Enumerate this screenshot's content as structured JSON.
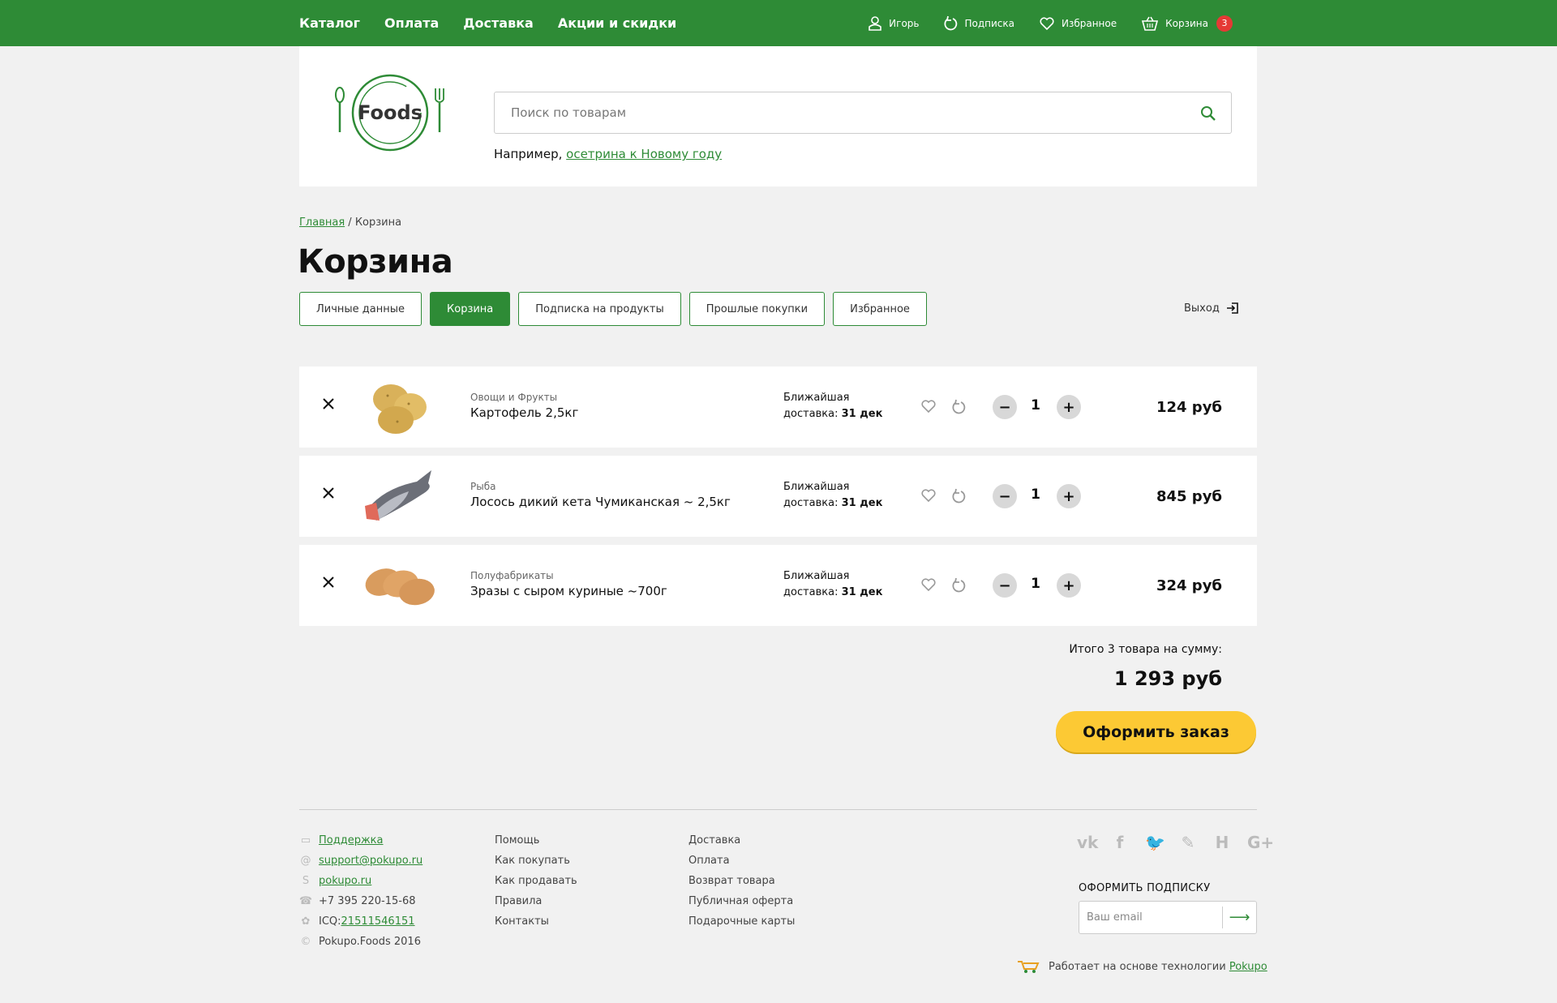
{
  "topnav": {
    "items": [
      "Каталог",
      "Оплата",
      "Доставка",
      "Акции и скидки"
    ]
  },
  "toputils": {
    "user": "Игорь",
    "subscription": "Подписка",
    "favorites": "Избранное",
    "cart": "Корзина",
    "cart_count": "3"
  },
  "header": {
    "logo_text": "Foods",
    "search_placeholder": "Поиск по товарам",
    "example_prefix": "Например, ",
    "example_link": "осетрина к Новому году"
  },
  "breadcrumb": {
    "home": "Главная",
    "separator": " / ",
    "current": "Корзина"
  },
  "page_title": "Корзина",
  "tabs": [
    "Личные данные",
    "Корзина",
    "Подписка на продукты",
    "Прошлые покупки",
    "Избранное"
  ],
  "active_tab": "Корзина",
  "logout": "Выход",
  "cart": {
    "delivery_label": "Ближайшая",
    "delivery_prefix": "доставка:",
    "items": [
      {
        "category": "Овощи и Фрукты",
        "name": "Картофель 2,5кг",
        "delivery_date": "31 дек",
        "qty": "1",
        "price": "124 руб",
        "image": "potatoes"
      },
      {
        "category": "Рыба",
        "name": "Лосось дикий кета Чумиканская ~ 2,5кг",
        "delivery_date": "31 дек",
        "qty": "1",
        "price": "845 руб",
        "image": "salmon"
      },
      {
        "category": "Полуфабрикаты",
        "name": "Зразы с сыром куриные ~700г",
        "delivery_date": "31 дек",
        "qty": "1",
        "price": "324 руб",
        "image": "cutlets"
      }
    ],
    "total_label": "Итого 3 товара на сумму:",
    "total_value": "1 293 руб",
    "order_button": "Оформить заказ"
  },
  "footer": {
    "contacts": {
      "support": "Поддержка",
      "email": "support@pokupo.ru",
      "skype": "pokupo.ru",
      "phone": "+7 395 220-15-68",
      "icq_prefix": "ICQ: ",
      "icq": "21511546151",
      "copyright": "Pokupo.Foods 2016"
    },
    "col2": [
      "Помощь",
      "Как покупать",
      "Как продавать",
      "Правила",
      "Контакты"
    ],
    "col3": [
      "Доставка",
      "Оплата",
      "Возврат товара",
      "Публичная оферта",
      "Подарочные карты"
    ],
    "social": [
      "vk",
      "f",
      "twitter",
      "livejournal",
      "H",
      "G+"
    ],
    "subscribe_title": "ОФОРМИТЬ ПОДПИСКУ",
    "email_placeholder": "Ваш email",
    "powered_text": "Работает на основе технологии ",
    "powered_link": "Pokupo"
  },
  "colors": {
    "brand_green": "#2e8b36",
    "accent_yellow": "#fcc934",
    "badge_red": "#e53935"
  }
}
